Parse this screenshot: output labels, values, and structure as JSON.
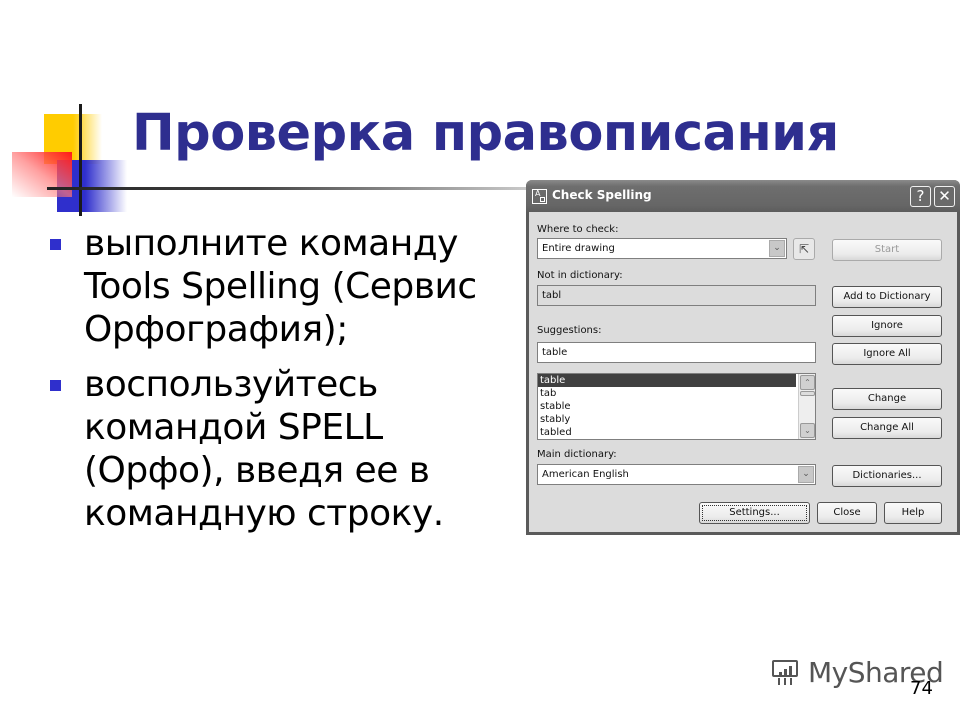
{
  "slide": {
    "title": "Проверка правописания",
    "bullets": [
      {
        "lines": [
          "выполните команду",
          "Tools Spelling (Сервис",
          "Орфография);"
        ]
      },
      {
        "lines": [
          "воспользуйтесь",
          "командой SPELL",
          "(Орфо), введя ее в",
          "командную строку."
        ]
      }
    ],
    "page_number": "74",
    "watermark": "MyShared",
    "colors": {
      "title": "#2e2e8f",
      "bullet": "#2f2fcc",
      "accent_yellow": "#ffcc00",
      "accent_red": "#ff1a1a"
    }
  },
  "dialog": {
    "title": "Check Spelling",
    "help_button": "?",
    "close_button": "✕",
    "where_to_check_label": "Where to check:",
    "where_to_check_value": "Entire drawing",
    "start_button": "Start",
    "not_in_dictionary_label": "Not in dictionary:",
    "not_in_dictionary_value": "tabl",
    "add_to_dictionary_button": "Add to Dictionary",
    "ignore_button": "Ignore",
    "ignore_all_button": "Ignore All",
    "suggestions_label": "Suggestions:",
    "suggestion_value": "table",
    "suggestions_list": [
      "table",
      "tab",
      "stable",
      "stably",
      "tabled"
    ],
    "selected_suggestion": "table",
    "change_button": "Change",
    "change_all_button": "Change All",
    "main_dictionary_label": "Main dictionary:",
    "main_dictionary_value": "American English",
    "dictionaries_button": "Dictionaries...",
    "settings_button": "Settings...",
    "close_dialog_button": "Close",
    "help_dialog_button": "Help"
  }
}
